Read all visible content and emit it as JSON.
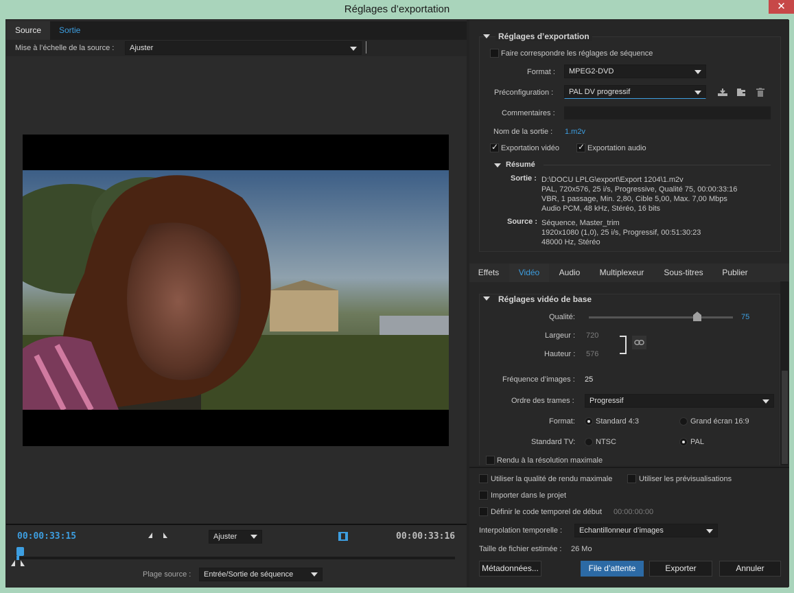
{
  "window": {
    "title": "Réglages d’exportation",
    "close_glyph": "✕"
  },
  "left": {
    "tabs": [
      {
        "label": "Source"
      },
      {
        "label": "Sortie"
      }
    ],
    "scale_label": "Mise à l’échelle de la source :",
    "scale_value": "Ajuster",
    "timecode_in": "00:00:33:15",
    "timecode_out": "00:00:33:16",
    "zoom_value": "Ajuster",
    "range_label": "Plage source :",
    "range_value": "Entrée/Sortie de séquence"
  },
  "export": {
    "section_title": "Réglages d’exportation",
    "match_sequence_label": "Faire correspondre les réglages de séquence",
    "format_label": "Format :",
    "format_value": "MPEG2-DVD",
    "preset_label": "Préconfiguration :",
    "preset_value": "PAL DV progressif",
    "comments_label": "Commentaires :",
    "comments_value": "",
    "output_name_label": "Nom de la sortie :",
    "output_name_value": "1.m2v",
    "export_video_label": "Exportation vidéo",
    "export_audio_label": "Exportation audio",
    "summary_title": "Résumé",
    "output_label": "Sortie :",
    "output_lines": [
      "D:\\DOCU LPLG\\export\\Export 1204\\1.m2v",
      "PAL, 720x576, 25 i/s, Progressive, Qualité  75, 00:00:33:16",
      "VBR, 1 passage, Min. 2,80, Cible 5,00, Max. 7,00 Mbps",
      "Audio PCM, 48  kHz, Stéréo, 16 bits"
    ],
    "source_label": "Source :",
    "source_lines": [
      "Séquence, Master_trim",
      "1920x1080 (1,0), 25  i/s, Progressif, 00:51:30:23",
      "48000 Hz, Stéréo"
    ]
  },
  "subtabs": [
    {
      "label": "Effets"
    },
    {
      "label": "Vidéo"
    },
    {
      "label": "Audio"
    },
    {
      "label": "Multiplexeur"
    },
    {
      "label": "Sous-titres"
    },
    {
      "label": "Publier"
    }
  ],
  "video": {
    "section_title": "Réglages vidéo de base",
    "quality_label": "Qualité:",
    "quality_value": "75",
    "quality_fraction": 0.75,
    "width_label": "Largeur :",
    "width_value": "720",
    "height_label": "Hauteur :",
    "height_value": "576",
    "framerate_label": "Fréquence d’images :",
    "framerate_value": "25",
    "field_order_label": "Ordre des trames :",
    "field_order_value": "Progressif",
    "aspect_label": "Format:",
    "aspect_standard": "Standard 4:3",
    "aspect_wide": "Grand écran 16:9",
    "tv_label": "Standard TV:",
    "tv_ntsc": "NTSC",
    "tv_pal": "PAL",
    "max_res_label": "Rendu à la résolution maximale"
  },
  "bottom": {
    "max_quality_label": "Utiliser la qualité de rendu maximale",
    "previews_label": "Utiliser les prévisualisations",
    "import_label": "Importer dans le projet",
    "timecode_label": "Définir le code temporel de début",
    "timecode_value": "00:00:00:00",
    "interp_label": "Interpolation temporelle :",
    "interp_value": "Echantillonneur d’images",
    "filesize_label": "Taille de fichier estimée :",
    "filesize_value": "26 Mo",
    "metadata_btn": "Métadonnées...",
    "queue_btn": "File d’attente",
    "export_btn": "Exporter",
    "cancel_btn": "Annuler"
  },
  "icons": [
    "close-icon",
    "triangle-down-icon",
    "save-preset-icon",
    "import-preset-icon",
    "trash-icon",
    "link-icon",
    "mark-in-icon",
    "mark-out-icon",
    "fit-icon",
    "playhead-icon",
    "checkbox-icon",
    "radio-icon"
  ]
}
